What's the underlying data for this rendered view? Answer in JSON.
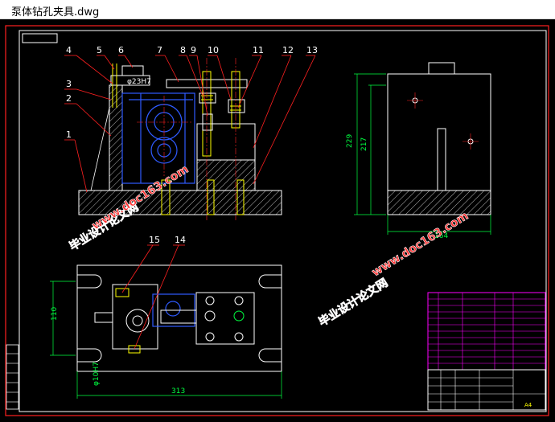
{
  "window": {
    "title": "泵体钻孔夹具.dwg"
  },
  "drawing": {
    "callouts": [
      "1",
      "2",
      "3",
      "4",
      "5",
      "6",
      "7",
      "8",
      "9",
      "10",
      "11",
      "12",
      "13"
    ],
    "callouts_plan": [
      "15",
      "14"
    ],
    "dims": {
      "bore": "φ23H7",
      "height_229": "229",
      "height_217": "217",
      "width_164": "164",
      "height_110": "110",
      "width_313": "313",
      "slot": "φ10H7"
    },
    "watermarks": {
      "cn_1": "毕业设计论文网",
      "url_1": "www.doc163.com",
      "cn_2": "毕业设计论文网",
      "url_2": "www.doc163.com"
    },
    "title_block": {
      "label_a": "A4"
    }
  }
}
